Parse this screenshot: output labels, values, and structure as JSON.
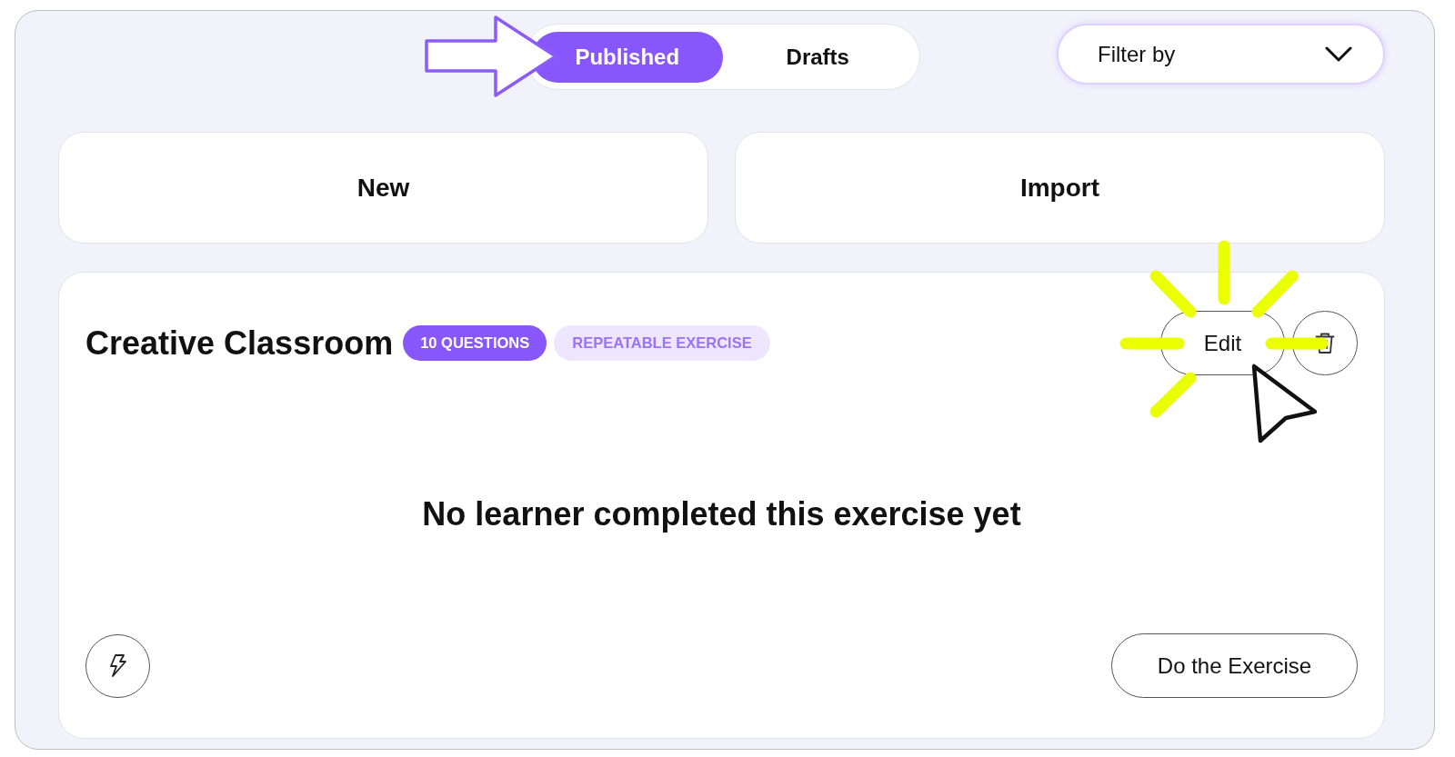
{
  "tabs": [
    {
      "label": "Published",
      "selected": true
    },
    {
      "label": "Drafts",
      "selected": false
    }
  ],
  "filter": {
    "label": "Filter by"
  },
  "actions": [
    "New",
    "Import"
  ],
  "exercise": {
    "title": "Creative Classroom",
    "badges": [
      {
        "label": "10 QUESTIONS",
        "kind": "solid"
      },
      {
        "label": "REPEATABLE EXERCISE",
        "kind": "soft"
      }
    ],
    "edit_button": "Edit",
    "empty_message": "No learner completed this exercise yet",
    "start_button": "Do the Exercise"
  }
}
